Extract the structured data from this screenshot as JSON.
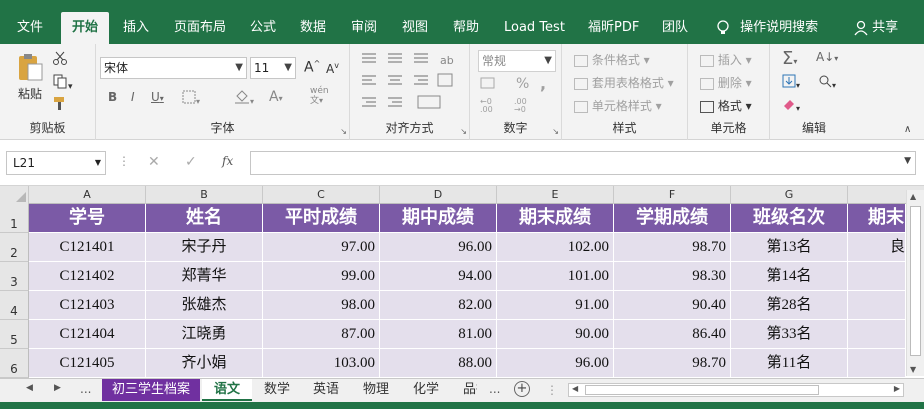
{
  "ribbon_tabs": [
    "文件",
    "开始",
    "插入",
    "页面布局",
    "公式",
    "数据",
    "审阅",
    "视图",
    "帮助",
    "Load Test",
    "福昕PDF",
    "团队",
    "操作说明搜索",
    "共享"
  ],
  "clipboard": {
    "paste": "粘贴",
    "label": "剪贴板"
  },
  "font": {
    "name": "宋体",
    "size": "11",
    "bold": "B",
    "italic": "I",
    "underline": "U",
    "grow": "A",
    "shrink": "A",
    "wen": "wén",
    "label": "字体"
  },
  "align": {
    "label": "对齐方式"
  },
  "number": {
    "format": "常规",
    "percent": "%",
    "comma": ",",
    "label": "数字"
  },
  "styles": {
    "conditional": "条件格式",
    "table": "套用表格格式",
    "cell": "单元格样式",
    "label": "样式"
  },
  "cells": {
    "insert": "插入",
    "delete": "删除",
    "format": "格式",
    "label": "单元格"
  },
  "editing": {
    "sigma": "Σ",
    "sort": "A",
    "label": "编辑"
  },
  "formula_bar": {
    "name_box": "L21",
    "fx": "fx",
    "value": ""
  },
  "columns": [
    "A",
    "B",
    "C",
    "D",
    "E",
    "F",
    "G"
  ],
  "row_numbers": [
    "1",
    "2",
    "3",
    "4",
    "5",
    "6"
  ],
  "headers": [
    "学号",
    "姓名",
    "平时成绩",
    "期中成绩",
    "期末成绩",
    "学期成绩",
    "班级名次",
    "期末"
  ],
  "rows": [
    [
      "C121401",
      "宋子丹",
      "97.00",
      "96.00",
      "102.00",
      "98.70",
      "第13名",
      "良"
    ],
    [
      "C121402",
      "郑菁华",
      "99.00",
      "94.00",
      "101.00",
      "98.30",
      "第14名",
      ""
    ],
    [
      "C121403",
      "张雄杰",
      "98.00",
      "82.00",
      "91.00",
      "90.40",
      "第28名",
      ""
    ],
    [
      "C121404",
      "江晓勇",
      "87.00",
      "81.00",
      "90.00",
      "86.40",
      "第33名",
      ""
    ],
    [
      "C121405",
      "齐小娟",
      "103.00",
      "88.00",
      "96.00",
      "98.70",
      "第11名",
      ""
    ]
  ],
  "sheet_tabs": [
    "初三学生档案",
    "语文",
    "数学",
    "英语",
    "物理",
    "化学",
    "品德"
  ],
  "sheet_nav": {
    "ellipsis": "...",
    "add": "+"
  },
  "colors": {
    "ribbon": "#217346",
    "header_fill": "#7b5aa6",
    "data_fill": "#e4dfec",
    "tab_purple": "#7030a0"
  }
}
